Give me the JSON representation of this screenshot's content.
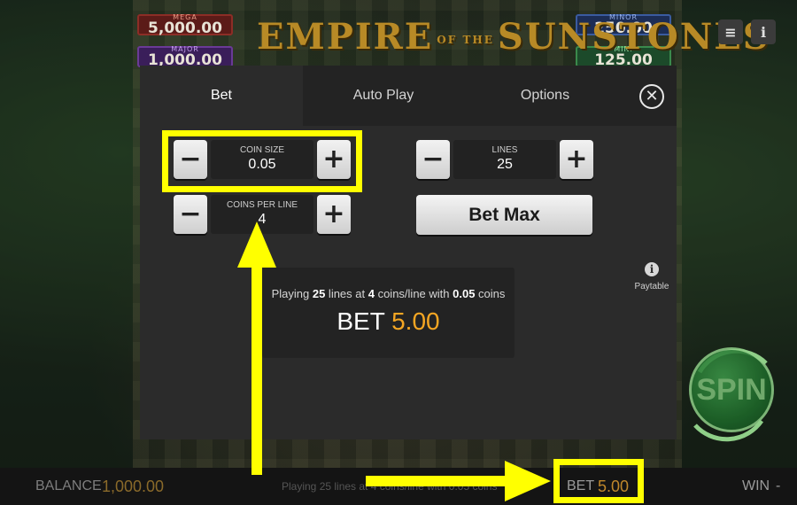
{
  "game": {
    "title_main": "EMPIRE",
    "title_small": "OF THE",
    "title_end": "SUNSTONES",
    "jackpots": [
      {
        "name": "MEGA",
        "value": "5,000.00"
      },
      {
        "name": "MAJOR",
        "value": "1,000.00"
      },
      {
        "name": "MINOR",
        "value": "250.00"
      },
      {
        "name": "MINI",
        "value": "125.00"
      }
    ],
    "menu_icon": "≡",
    "info_icon": "i",
    "spin_label": "SPIN"
  },
  "modal": {
    "tabs": {
      "bet": "Bet",
      "auto_play": "Auto Play",
      "options": "Options"
    },
    "close_icon": "✕",
    "coin_size": {
      "label": "COIN SIZE",
      "value": "0.05"
    },
    "coins_per_line": {
      "label": "COINS PER LINE",
      "value": "4"
    },
    "lines": {
      "label": "LINES",
      "value": "25"
    },
    "minus": "−",
    "plus": "+",
    "bet_max_label": "Bet Max",
    "paytable": {
      "icon": "i",
      "label": "Paytable"
    },
    "summary": {
      "playing": "Playing ",
      "lines_value": "25",
      "lines_text": " lines at ",
      "coins_value": "4",
      "coins_text": " coins/line with ",
      "coin_value": "0.05",
      "coin_text": " coins",
      "bet_label": "BET ",
      "bet_amount": "5.00"
    }
  },
  "bottom_bar": {
    "balance_label": "BALANCE",
    "balance_value": "1,000.00",
    "message": "Playing 25 lines at 4 coins/line with 0.05 coins",
    "bet_label": "BET",
    "bet_value": "5.00",
    "win_label": "WIN",
    "win_value": "-"
  },
  "colors": {
    "highlight": "#ffff00",
    "bet_amount": "#f5a623",
    "modal_bg": "#2b2b2b"
  }
}
